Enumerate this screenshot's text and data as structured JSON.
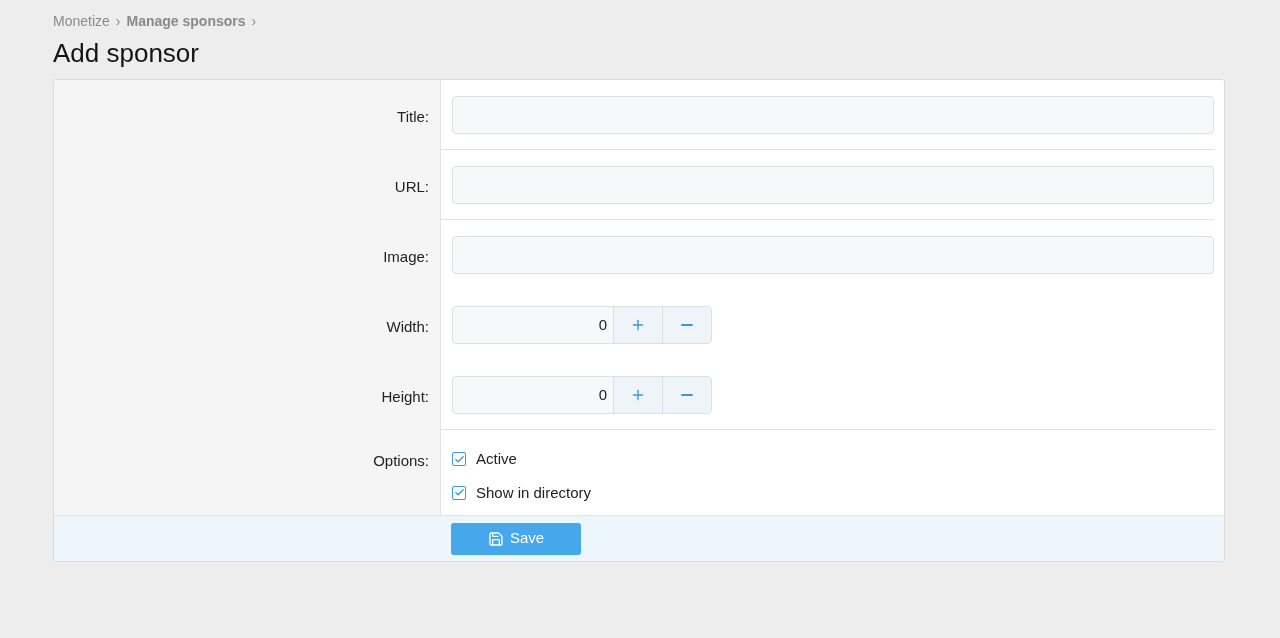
{
  "breadcrumb": [
    {
      "label": "Monetize",
      "bold": false
    },
    {
      "label": "Manage sponsors",
      "bold": true
    }
  ],
  "breadcrumb_separator": "›",
  "page_title": "Add sponsor",
  "rows": [
    {
      "kind": "text",
      "label": "Title:",
      "divider_after": true
    },
    {
      "kind": "text",
      "label": "URL:",
      "divider_after": true
    },
    {
      "kind": "text",
      "label": "Image:",
      "divider_after": false
    },
    {
      "kind": "number",
      "label": "Width:",
      "value": "0",
      "divider_after": false
    },
    {
      "kind": "number",
      "label": "Height:",
      "value": "0",
      "divider_after": true
    },
    {
      "kind": "checkboxes",
      "label": "Options:",
      "options": [
        {
          "label": "Active",
          "checked": true
        },
        {
          "label": "Show in directory",
          "checked": true
        }
      ],
      "divider_after": false
    }
  ],
  "save_button": "Save"
}
